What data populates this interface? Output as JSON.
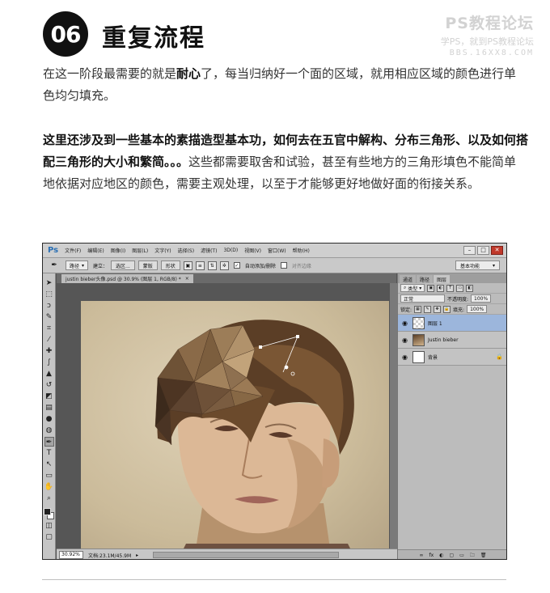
{
  "header": {
    "step_number": "06",
    "title": "重复流程",
    "watermark_line1": "PS教程论坛",
    "watermark_line2": "学PS，就到PS教程论坛",
    "watermark_line3": "BBS.16XX8.COM"
  },
  "paragraph1": {
    "part1": "在这一阶段最需要的就是",
    "bold": "耐心",
    "part2": "了，每当归纳好一个面的区域，就用相应区域的颜色进行单色均匀填充。"
  },
  "paragraph2": {
    "bold": "这里还涉及到一些基本的素描造型基本功，如何去在五官中解构、分布三角形、以及如何搭配三角形的大小和繁简。。。",
    "rest": "这些都需要取舍和试验，甚至有些地方的三角形填色不能简单地依据对应地区的颜色，需要主观处理，以至于才能够更好地做好面的衔接关系。"
  },
  "photoshop": {
    "logo": "Ps",
    "menu": [
      "文件(F)",
      "编辑(E)",
      "图像(I)",
      "图层(L)",
      "文字(Y)",
      "选择(S)",
      "滤镜(T)",
      "3D(D)",
      "视图(V)",
      "窗口(W)",
      "帮助(H)"
    ],
    "window_buttons": [
      "–",
      "□",
      "✕"
    ],
    "options": {
      "tool_icon": "✒",
      "mode_select": "路径",
      "build_label": "建立：",
      "selection_button": "选区...",
      "mask_button": "蒙版",
      "shape_button": "形状",
      "auto_add_delete": "自动添加/删除",
      "align_edges": "对齐边缘",
      "workspace": "基本功能"
    },
    "document_tab": "justin bieber头像.psd @ 30.9% (图层 1, RGB/8) *",
    "zoom": "30.92%",
    "doc_size": "文档:23.1M/45.9M",
    "panel_tabs": [
      "通道",
      "路径",
      "图层"
    ],
    "layer_filter": "类型",
    "blend_mode": "正常",
    "opacity_label": "不透明度:",
    "opacity_value": "100%",
    "lock_label": "锁定:",
    "fill_label": "填充:",
    "fill_value": "100%",
    "layers": [
      {
        "name": "图层 1",
        "active": true
      },
      {
        "name": "Justin bieber",
        "active": false
      },
      {
        "name": "背景",
        "active": false,
        "locked": true
      }
    ],
    "panel_bottom_icons": [
      "∞",
      "fx",
      "◐",
      "▢",
      "▭",
      "🗀",
      "🗑"
    ]
  },
  "colors": {
    "accent_layer": "#9cb6dc",
    "badge": "#111111",
    "watermark": "#d2d2d2"
  }
}
